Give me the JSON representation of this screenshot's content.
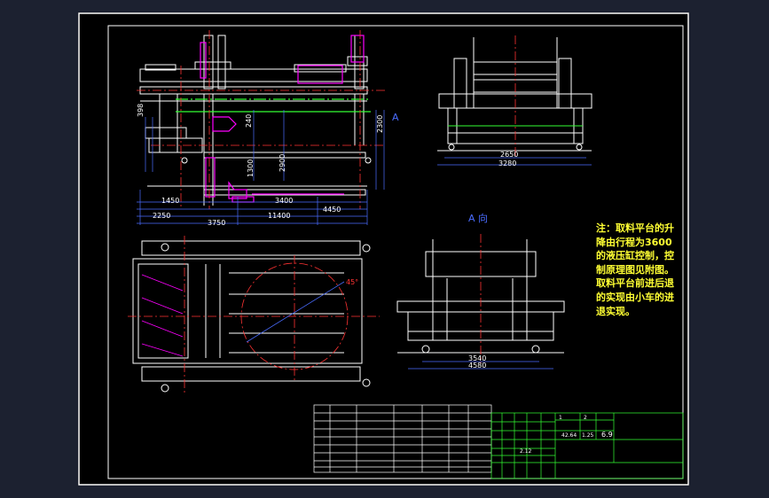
{
  "note_text": "注：取料平台的升降由行程为3600的液压缸控制，控制原理图见附图。取料平台前进后退的实现由小车的进退实现。",
  "view_label": "A 向",
  "section_marker": "A",
  "dimensions": {
    "front_bottom": [
      "1450",
      "3400",
      "4450",
      "2250",
      "11400",
      "3750"
    ],
    "front_vertical": [
      "398",
      "240",
      "1300",
      "2900",
      "2300"
    ],
    "top_right": [
      "2650",
      "3280"
    ],
    "a_view": [
      "3540",
      "4580"
    ],
    "plan_angle": "45°"
  },
  "title_block": {
    "numbers": [
      "1",
      "2",
      "42.64",
      "1.25",
      "6.9"
    ],
    "dims": [
      "2.12"
    ]
  },
  "colors": {
    "frame": "#ffffff",
    "structure": "#ffffff",
    "centerline": "#ff3333",
    "dimension": "#4a6cff",
    "highlight": "#ff00ff",
    "green": "#33ff33",
    "note": "#ffff33"
  }
}
